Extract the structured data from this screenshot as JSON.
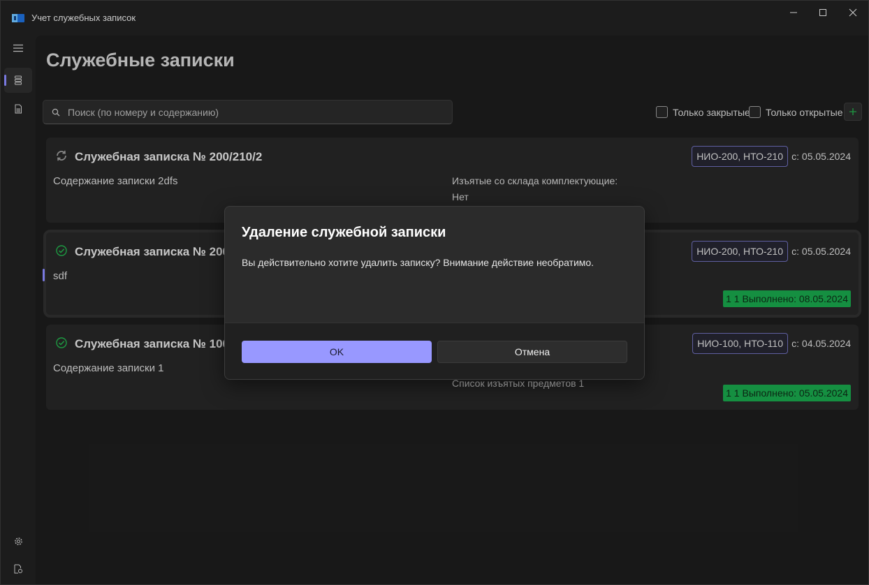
{
  "window": {
    "title": "Учет служебных записок"
  },
  "nav": {
    "items": [
      {
        "icon": "hamburger-icon"
      },
      {
        "icon": "list-icon",
        "active": true
      },
      {
        "icon": "document-icon"
      },
      {
        "icon": "gear-icon"
      },
      {
        "icon": "document-settings-icon"
      }
    ]
  },
  "page": {
    "title": "Служебные записки"
  },
  "search": {
    "placeholder": "Поиск (по номеру и содержанию)"
  },
  "filters": {
    "closed_only": "Только закрытые",
    "open_only": "Только открытые"
  },
  "cards": [
    {
      "status": "in-progress",
      "title": "Служебная записка № 200/210/2",
      "description": "Содержание записки 2dfs",
      "departments": "НИО-200, НТО-210",
      "since": "с: 05.05.2024",
      "side_label": "Изъятые со склада комплектующие:",
      "side_value": "Нет"
    },
    {
      "status": "done",
      "title": "Служебная записка № 200/",
      "description": "sdf",
      "departments": "НИО-200, НТО-210",
      "since": "с: 05.05.2024",
      "completed": "1 1 Выполнено: 08.05.2024"
    },
    {
      "status": "done",
      "title": "Служебная записка № 100/",
      "description": "Содержание записки 1",
      "departments": "НИО-100, НТО-110",
      "since": "с: 04.05.2024",
      "side_value": "Список изъятых предметов 1",
      "completed": "1 1 Выполнено: 05.05.2024"
    }
  ],
  "dialog": {
    "title": "Удаление служебной записки",
    "message": "Вы действительно хотите удалить записку? Внимание действие необратимо.",
    "ok_label": "OK",
    "cancel_label": "Отмена"
  },
  "colors": {
    "accent": "#9898ff",
    "success": "#19a34a",
    "background": "#1c1c1c"
  }
}
